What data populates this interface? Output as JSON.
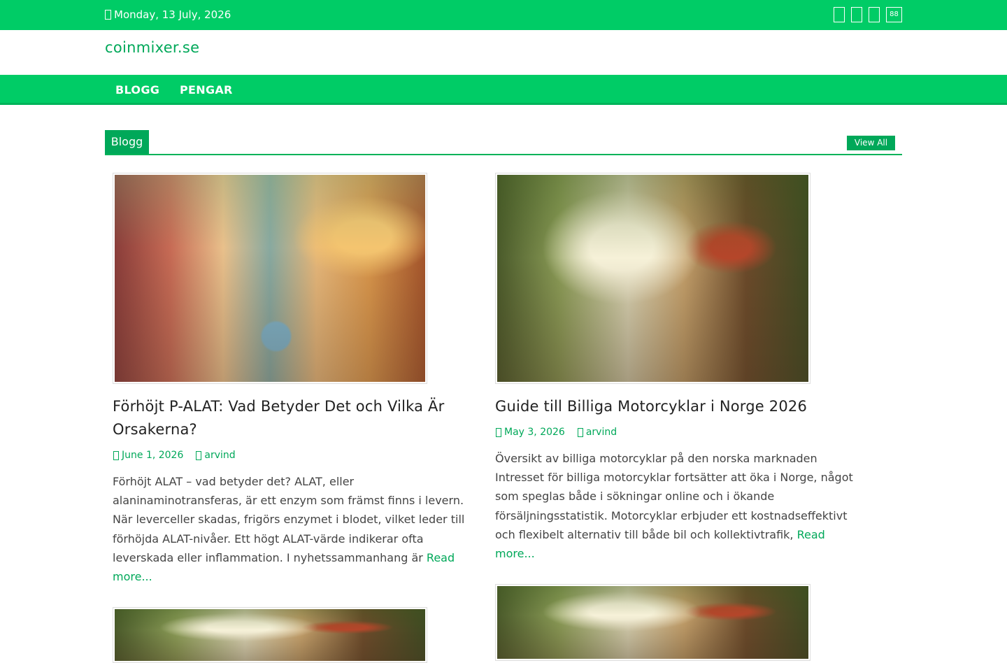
{
  "topbar": {
    "date": "Monday, 13 July, 2026",
    "icons": [
      "facebook-icon",
      "twitter-icon",
      "instagram-icon",
      "grid-icon"
    ],
    "icon_glyphs": [
      "",
      "",
      "",
      "88"
    ]
  },
  "site": {
    "title": "coinmixer.se"
  },
  "nav": {
    "items": [
      {
        "label": "BLOGG"
      },
      {
        "label": "PENGAR"
      }
    ]
  },
  "section": {
    "title": "Blogg",
    "view_all": "View All"
  },
  "posts": [
    {
      "title": "Förhöjt P-ALAT: Vad Betyder Det och Vilka Är Orsakerna?",
      "date": "June 1, 2026",
      "author": "arvind",
      "excerpt": "Förhöjt ALAT – vad betyder det? ALAT, eller alaninaminotransferas, är ett enzym som främst finns i levern. När leverceller skadas, frigörs enzymet i blodet, vilket leder till förhöjda ALAT-nivåer. Ett högt ALAT-värde indikerar ofta leverskada eller inflammation. I nyhetssammanhang är ",
      "read_more": "Read more..."
    },
    {
      "title": "Guide till Billiga Motorcyklar i Norge 2026",
      "date": "May 3, 2026",
      "author": "arvind",
      "excerpt": "Översikt av billiga motorcyklar på den norska marknaden Intresset för billiga motorcyklar fortsätter att öka i Norge, något som speglas både i sökningar online och i ökande försäljningsstatistik. Motorcyklar erbjuder ett kostnadseffektivt och flexibelt alternativ till både bil och kollektivtrafik, ",
      "read_more": "Read more..."
    }
  ],
  "colors": {
    "brand_green": "#00cc66",
    "accent_green": "#00a859"
  }
}
